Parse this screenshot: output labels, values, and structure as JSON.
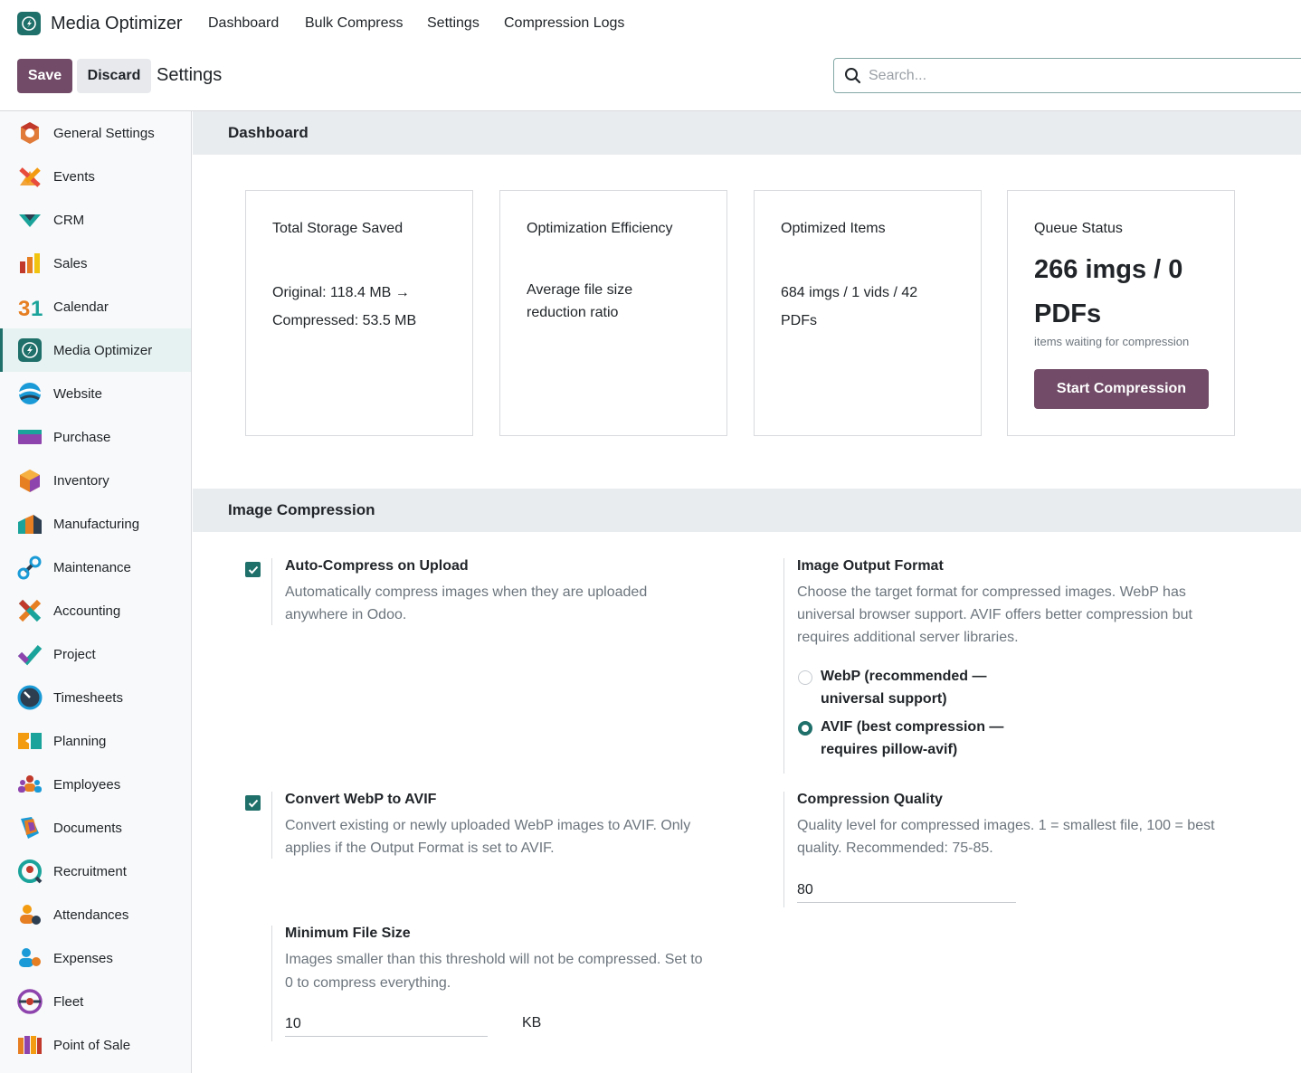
{
  "app": {
    "title": "Media Optimizer",
    "menu": [
      "Dashboard",
      "Bulk Compress",
      "Settings",
      "Compression Logs"
    ]
  },
  "control": {
    "save_label": "Save",
    "discard_label": "Discard",
    "breadcrumb": "Settings",
    "search_placeholder": "Search..."
  },
  "sidebar": {
    "items": [
      {
        "label": "General Settings",
        "icon": "general-settings-icon"
      },
      {
        "label": "Events",
        "icon": "events-icon"
      },
      {
        "label": "CRM",
        "icon": "crm-icon"
      },
      {
        "label": "Sales",
        "icon": "sales-icon"
      },
      {
        "label": "Calendar",
        "icon": "calendar-icon"
      },
      {
        "label": "Media Optimizer",
        "icon": "media-optimizer-icon",
        "active": true
      },
      {
        "label": "Website",
        "icon": "website-icon"
      },
      {
        "label": "Purchase",
        "icon": "purchase-icon"
      },
      {
        "label": "Inventory",
        "icon": "inventory-icon"
      },
      {
        "label": "Manufacturing",
        "icon": "manufacturing-icon"
      },
      {
        "label": "Maintenance",
        "icon": "maintenance-icon"
      },
      {
        "label": "Accounting",
        "icon": "accounting-icon"
      },
      {
        "label": "Project",
        "icon": "project-icon"
      },
      {
        "label": "Timesheets",
        "icon": "timesheets-icon"
      },
      {
        "label": "Planning",
        "icon": "planning-icon"
      },
      {
        "label": "Employees",
        "icon": "employees-icon"
      },
      {
        "label": "Documents",
        "icon": "documents-icon"
      },
      {
        "label": "Recruitment",
        "icon": "recruitment-icon"
      },
      {
        "label": "Attendances",
        "icon": "attendances-icon"
      },
      {
        "label": "Expenses",
        "icon": "expenses-icon"
      },
      {
        "label": "Fleet",
        "icon": "fleet-icon"
      },
      {
        "label": "Point of Sale",
        "icon": "point-of-sale-icon"
      }
    ]
  },
  "dashboard": {
    "heading": "Dashboard",
    "cards": {
      "storage": {
        "title": "Total Storage Saved",
        "line1": "Original: 118.4 MB →",
        "line2": "Compressed: 53.5 MB"
      },
      "efficiency": {
        "title": "Optimization Efficiency",
        "line1": "Average file size",
        "line2": "reduction ratio"
      },
      "items": {
        "title": "Optimized Items",
        "line1": "684 imgs / 1 vids / 42",
        "line2": "PDFs"
      },
      "queue": {
        "title": "Queue Status",
        "big1": "266 imgs / 0",
        "big2": "PDFs",
        "small": "items waiting for compression",
        "button": "Start Compression"
      }
    }
  },
  "image_compression": {
    "heading": "Image Compression",
    "auto_compress": {
      "title": "Auto-Compress on Upload",
      "desc1": "Automatically compress images when they are uploaded",
      "desc2": "anywhere in Odoo.",
      "checked": true
    },
    "output_format": {
      "title": "Image Output Format",
      "desc1": "Choose the target format for compressed images. WebP has",
      "desc2": "universal browser support. AVIF offers better compression but",
      "desc3": "requires additional server libraries.",
      "options": [
        {
          "line1": "WebP (recommended —",
          "line2": "universal support)",
          "checked": false
        },
        {
          "line1": "AVIF (best compression —",
          "line2": "requires pillow-avif)",
          "checked": true
        }
      ]
    },
    "convert_webp": {
      "title": "Convert WebP to AVIF",
      "desc1": "Convert existing or newly uploaded WebP images to AVIF. Only",
      "desc2": "applies if the Output Format is set to AVIF.",
      "checked": true
    },
    "quality": {
      "title": "Compression Quality",
      "desc1": "Quality level for compressed images. 1 = smallest file, 100 = best",
      "desc2": "quality. Recommended: 75-85.",
      "value": "80"
    },
    "min_size": {
      "title": "Minimum File Size",
      "desc1": "Images smaller than this threshold will not be compressed. Set to",
      "desc2": "0 to compress everything.",
      "value": "10",
      "unit": "KB"
    }
  },
  "colors": {
    "brand": "#714b67",
    "accent": "#1f6f6a"
  }
}
